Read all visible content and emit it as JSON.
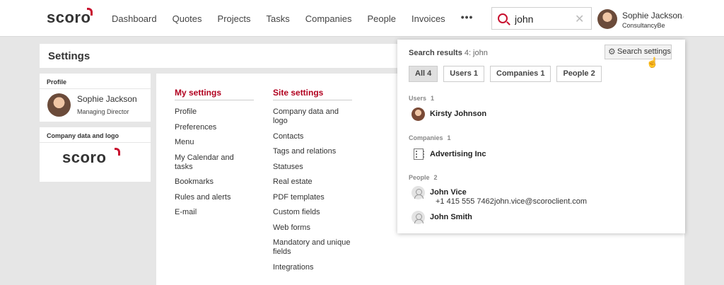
{
  "app": {
    "logo_text": "scoro",
    "nav": [
      "Dashboard",
      "Quotes",
      "Projects",
      "Tasks",
      "Companies",
      "People",
      "Invoices"
    ],
    "nav_more": "•••",
    "search": {
      "value": "john"
    },
    "user": {
      "name": "Sophie Jackson",
      "company": "ConsultancyBe"
    }
  },
  "settings": {
    "title": "Settings",
    "profile_card": {
      "title": "Profile",
      "name": "Sophie Jackson",
      "role": "Managing Director"
    },
    "company_card": {
      "title": "Company data and logo",
      "logo_text": "scoro"
    },
    "my_settings": {
      "heading": "My settings",
      "links": [
        "Profile",
        "Preferences",
        "Menu",
        "My Calendar and tasks",
        "Bookmarks",
        "Rules and alerts",
        "E-mail"
      ]
    },
    "site_settings": {
      "heading": "Site settings",
      "links": [
        "Company data and logo",
        "Contacts",
        "Tags and relations",
        "Statuses",
        "Real estate",
        "PDF templates",
        "Custom fields",
        "Web forms",
        "Mandatory and unique fields",
        "Integrations"
      ]
    }
  },
  "search_results": {
    "title": "Search results",
    "count": "4: john",
    "settings_button": "Search settings",
    "filters": [
      "All 4",
      "Users 1",
      "Companies 1",
      "People 2"
    ],
    "groups": {
      "users": {
        "label": "Users",
        "count": "1",
        "items": [
          {
            "name": "Kirsty Johnson",
            "icon": "avatar-icon"
          }
        ]
      },
      "companies": {
        "label": "Companies",
        "count": "1",
        "items": [
          {
            "name": "Advertising Inc",
            "icon": "building-icon"
          }
        ]
      },
      "people": {
        "label": "People",
        "count": "2",
        "items": [
          {
            "name": "John Vice",
            "phone": "+1 415 555 7462",
            "email": "john.vice@scoroclient.com",
            "icon": "person-icon"
          },
          {
            "name": "John Smith",
            "icon": "person-icon"
          }
        ]
      }
    }
  },
  "colors": {
    "accent": "#c8102e",
    "heading_red": "#b1001f"
  }
}
